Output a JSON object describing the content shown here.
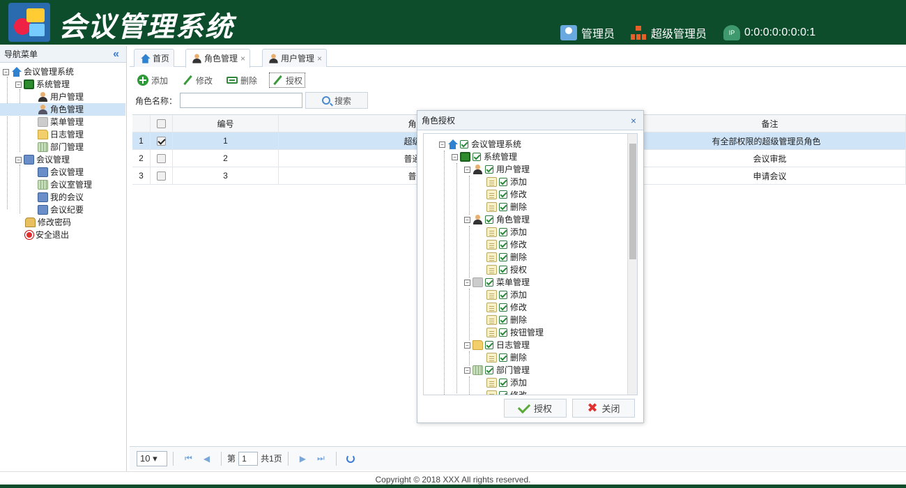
{
  "header": {
    "title": "会议管理系统",
    "user_role": "管理员",
    "user_group": "超级管理员",
    "ip_badge": "IP",
    "ip": "0:0:0:0:0:0:0:1"
  },
  "nav": {
    "title": "导航菜单",
    "collapse": "«",
    "items": [
      {
        "label": "会议管理系统",
        "icon": "home-icon"
      },
      {
        "label": "系统管理",
        "icon": "settings-icon"
      },
      {
        "label": "用户管理",
        "icon": "user-icon"
      },
      {
        "label": "角色管理",
        "icon": "role-icon"
      },
      {
        "label": "菜单管理",
        "icon": "menu-icon"
      },
      {
        "label": "日志管理",
        "icon": "folder-icon"
      },
      {
        "label": "部门管理",
        "icon": "grid-icon"
      },
      {
        "label": "会议管理",
        "icon": "monitor-icon"
      },
      {
        "label": "会议管理",
        "icon": "meeting-icon"
      },
      {
        "label": "会议室管理",
        "icon": "room-icon"
      },
      {
        "label": "我的会议",
        "icon": "calendar-icon"
      },
      {
        "label": "会议纪要",
        "icon": "notes-icon"
      },
      {
        "label": "修改密码",
        "icon": "lock-icon"
      },
      {
        "label": "安全退出",
        "icon": "exit-icon"
      }
    ]
  },
  "tabs": [
    {
      "label": "首页"
    },
    {
      "label": "角色管理",
      "close": "×"
    },
    {
      "label": "用户管理",
      "close": "×"
    }
  ],
  "toolbar": {
    "add": "添加",
    "edit": "修改",
    "delete": "删除",
    "authorize": "授权"
  },
  "search": {
    "label": "角色名称：",
    "value": "",
    "button": "搜索"
  },
  "grid": {
    "columns": [
      "编号",
      "角色名称",
      "备注"
    ],
    "rows": [
      {
        "rownum": "1",
        "id": "1",
        "name": "超级管理员",
        "remark": "有全部权限的超级管理员角色",
        "checked": true
      },
      {
        "rownum": "2",
        "id": "2",
        "name": "普通管理员",
        "remark": "会议审批",
        "checked": false
      },
      {
        "rownum": "3",
        "id": "3",
        "name": "普通用户",
        "remark": "申请会议",
        "checked": false
      }
    ]
  },
  "pager": {
    "page_size": "10 ▾",
    "first": "⏮",
    "prev": "◀",
    "page_label": "第",
    "page": "1",
    "total_label": "共1页",
    "next": "▶",
    "last": "⏭"
  },
  "dialog": {
    "title": "角色授权",
    "close": "×",
    "tree": [
      {
        "label": "会议管理系统",
        "level": 0
      },
      {
        "label": "系统管理",
        "level": 1
      },
      {
        "label": "用户管理",
        "level": 2
      },
      {
        "label": "添加",
        "level": 3
      },
      {
        "label": "修改",
        "level": 3
      },
      {
        "label": "删除",
        "level": 3
      },
      {
        "label": "角色管理",
        "level": 2
      },
      {
        "label": "添加",
        "level": 3
      },
      {
        "label": "修改",
        "level": 3
      },
      {
        "label": "删除",
        "level": 3
      },
      {
        "label": "授权",
        "level": 3
      },
      {
        "label": "菜单管理",
        "level": 2
      },
      {
        "label": "添加",
        "level": 3
      },
      {
        "label": "修改",
        "level": 3
      },
      {
        "label": "删除",
        "level": 3
      },
      {
        "label": "按钮管理",
        "level": 3
      },
      {
        "label": "日志管理",
        "level": 2
      },
      {
        "label": "删除",
        "level": 3
      },
      {
        "label": "部门管理",
        "level": 2
      },
      {
        "label": "添加",
        "level": 3
      },
      {
        "label": "修改",
        "level": 3
      }
    ],
    "ok": "授权",
    "cancel": "关闭"
  },
  "footer": {
    "copyright": "Copyright © 2018 XXX All rights reserved."
  }
}
